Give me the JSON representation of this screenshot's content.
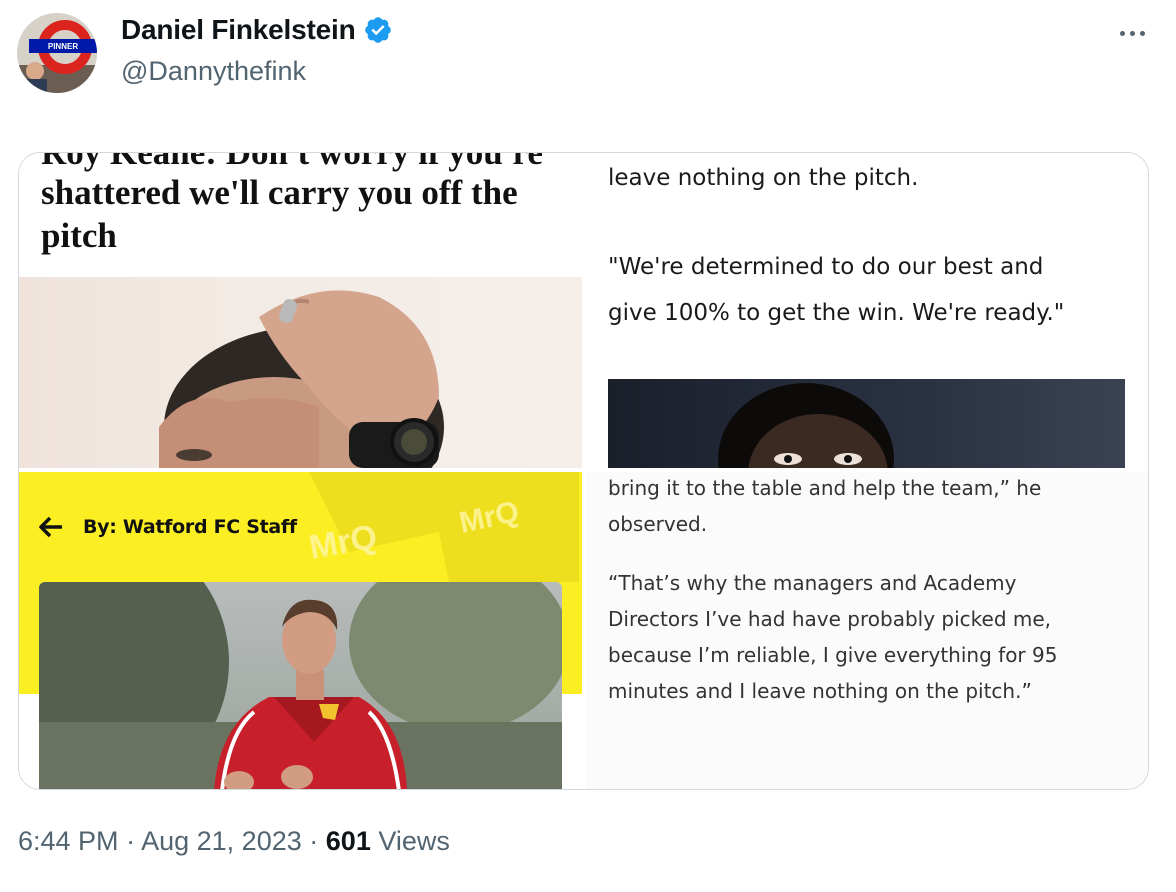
{
  "tweet": {
    "author_name": "Daniel Finkelstein",
    "author_handle": "@Dannythefink",
    "avatar_sign_text": "PINNER",
    "verified_icon": "verified-badge-icon",
    "time": "6:44 PM",
    "date": "Aug 21, 2023",
    "separator": "·",
    "views_count": "601",
    "views_label": "Views"
  },
  "panels": {
    "times": {
      "cut_line": "Roy Keane: Don't worry if you're",
      "headline": "shattered we'll carry you off the pitch"
    },
    "quote_top": {
      "line1": "leave nothing on the pitch.",
      "line2": "\"We're determined to do our best and",
      "line3": "give 100% to get the win. We're ready.\""
    },
    "watford": {
      "byline": "By: Watford FC Staff",
      "back_icon": "arrow-left-icon",
      "shirt_sponsor": "MrQ"
    },
    "quote_bottom": {
      "line1": "bring it to the table and help the team,” he",
      "line2": "observed.",
      "line3": "“That’s why the managers and Academy",
      "line4": "Directors I’ve had have probably picked me,",
      "line5": "because I’m reliable, I give everything for 95",
      "line6": "minutes and I leave nothing on the pitch.”"
    }
  },
  "colors": {
    "verified_blue": "#1d9bf0",
    "watford_yellow": "#fbee23",
    "secondary_text": "#536471",
    "underground_red": "#dc241f",
    "underground_blue": "#0019a8"
  }
}
